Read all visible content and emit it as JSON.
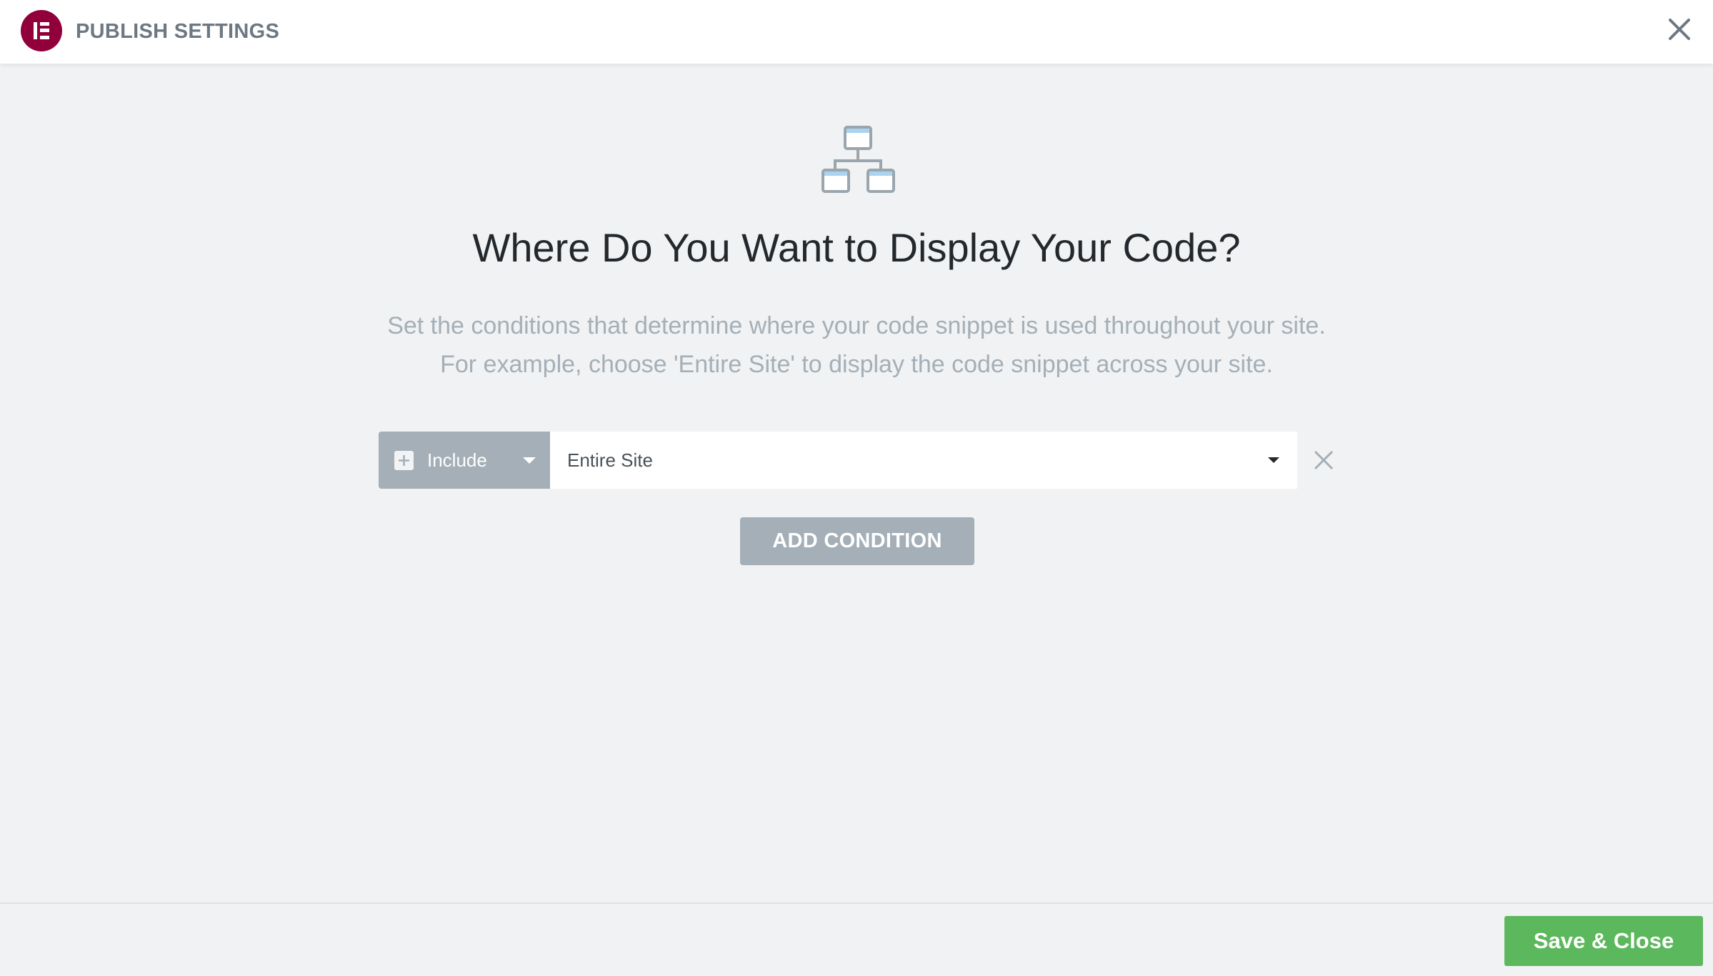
{
  "header": {
    "title": "PUBLISH SETTINGS",
    "logo_icon": "elementor-logo-icon",
    "close_icon": "close-icon"
  },
  "main": {
    "illustration_icon": "sitemap-icon",
    "headline": "Where Do You Want to Display Your Code?",
    "description_line1": "Set the conditions that determine where your code snippet is used throughout your site.",
    "description_line2": "For example, choose 'Entire Site' to display the code snippet across your site."
  },
  "condition": {
    "type_value": "Include",
    "type_icon": "plus-square-icon",
    "target_value": "Entire Site",
    "remove_icon": "close-icon"
  },
  "add_condition_label": "ADD CONDITION",
  "footer": {
    "save_label": "Save & Close"
  },
  "colors": {
    "brand": "#92003b",
    "muted": "#a4afb7",
    "save": "#5cb85c",
    "heading": "#23282d"
  }
}
